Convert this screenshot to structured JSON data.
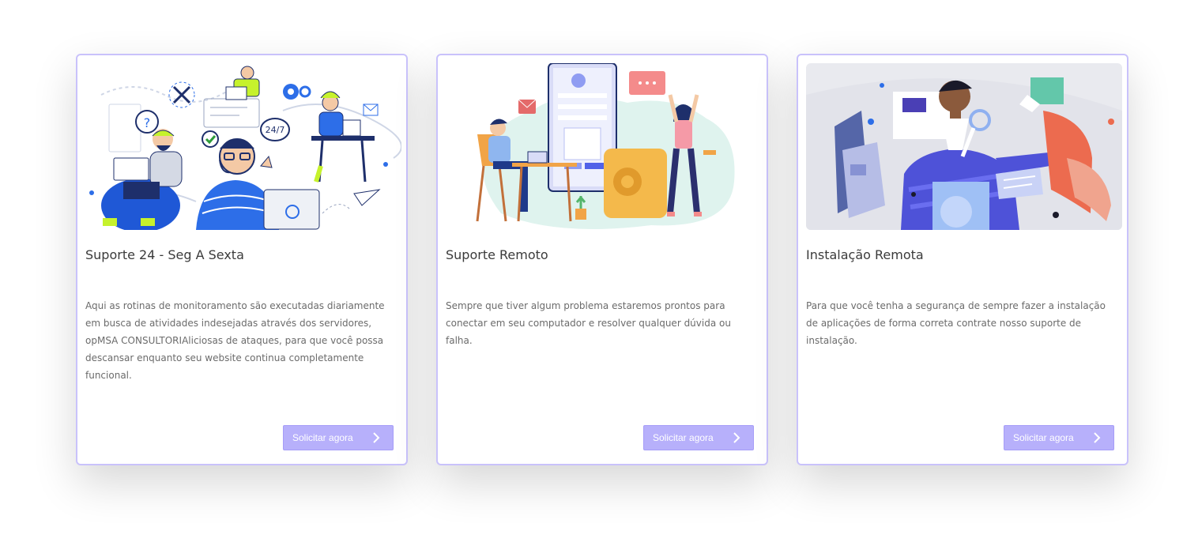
{
  "cards": [
    {
      "title": "Suporte 24 - Seg A Sexta",
      "description": "Aqui as rotinas de monitoramento são executadas diariamente em busca de atividades indesejadas através dos servidores, opMSA CONSULTORIAliciosas de ataques, para que você possa descansar enquanto seu website continua completamente funcional.",
      "button_label": "Solicitar agora",
      "illustration_text": {
        "badge": "24/7",
        "question": "?"
      }
    },
    {
      "title": "Suporte Remoto",
      "description": "Sempre que tiver algum problema estaremos prontos para conectar em seu computador e resolver qualquer dúvida ou falha.",
      "button_label": "Solicitar agora"
    },
    {
      "title": "Instalação Remota",
      "description": "Para que você tenha a segurança de sempre fazer a instalação de aplicações de forma correta contrate nosso suporte de instalação.",
      "button_label": "Solicitar agora"
    }
  ],
  "colors": {
    "card_border": "#c9c2fb",
    "button_bg": "#b7b0fb",
    "title": "#3b3b3b",
    "text": "#6b6b6b"
  },
  "icons": [
    "chevron-right-icon"
  ]
}
